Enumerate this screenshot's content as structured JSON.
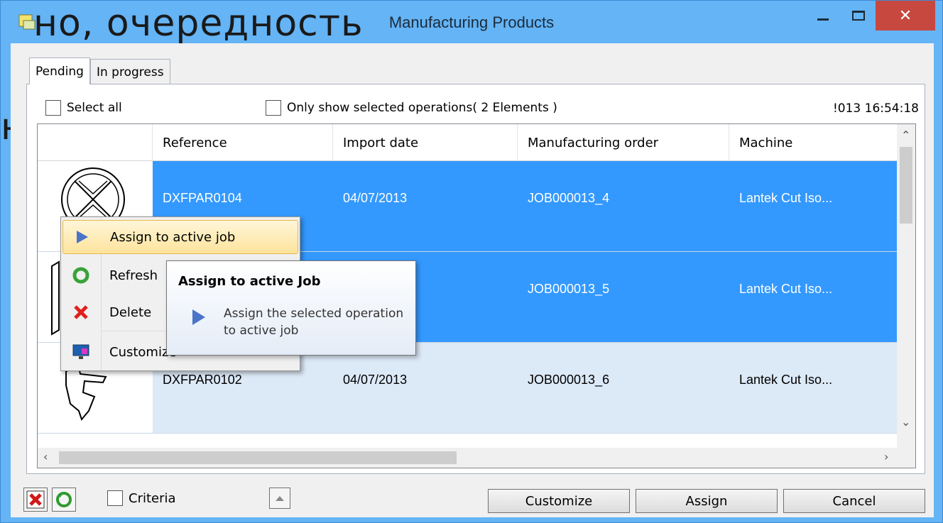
{
  "window": {
    "title": "Manufacturing Products",
    "close_glyph": "✕"
  },
  "background_text": {
    "line1": "но, очередность",
    "line2": "н"
  },
  "tabs": [
    {
      "label": "Pending",
      "active": true
    },
    {
      "label": "In progress",
      "active": false
    }
  ],
  "toolbar": {
    "select_all_label": "Select all",
    "only_selected_label": "Only show selected operations( 2 Elements )",
    "timestamp": "!013 16:54:18"
  },
  "grid": {
    "columns": [
      "Reference",
      "Import date",
      "Manufacturing order",
      "Machine"
    ],
    "rows": [
      {
        "reference": "DXFPAR0104",
        "import_date": "04/07/2013",
        "order": "JOB000013_4",
        "machine": "Lantek Cut Iso...",
        "state": "selected"
      },
      {
        "reference": "",
        "import_date": "",
        "order": "JOB000013_5",
        "machine": "Lantek Cut Iso...",
        "state": "selected"
      },
      {
        "reference": "DXFPAR0102",
        "import_date": "04/07/2013",
        "order": "JOB000013_6",
        "machine": "Lantek Cut Iso...",
        "state": "light"
      }
    ]
  },
  "context_menu": {
    "items": [
      {
        "label": "Assign to active job",
        "icon": "play-arrow-icon"
      },
      {
        "label": "Refresh",
        "icon": "refresh-icon"
      },
      {
        "label": "Delete",
        "icon": "delete-x-icon"
      },
      {
        "label": "Customize",
        "icon": "monitor-icon"
      }
    ]
  },
  "tooltip": {
    "title": "Assign to active Job",
    "body": "Assign the selected operation to active job"
  },
  "bottom": {
    "criteria_label": "Criteria",
    "customize_label": "Customize",
    "assign_label": "Assign",
    "cancel_label": "Cancel"
  },
  "colors": {
    "titlebar": "#64b4f6",
    "selection": "#3399ff",
    "light_row": "#dce9f7",
    "close_button": "#c7483f"
  }
}
